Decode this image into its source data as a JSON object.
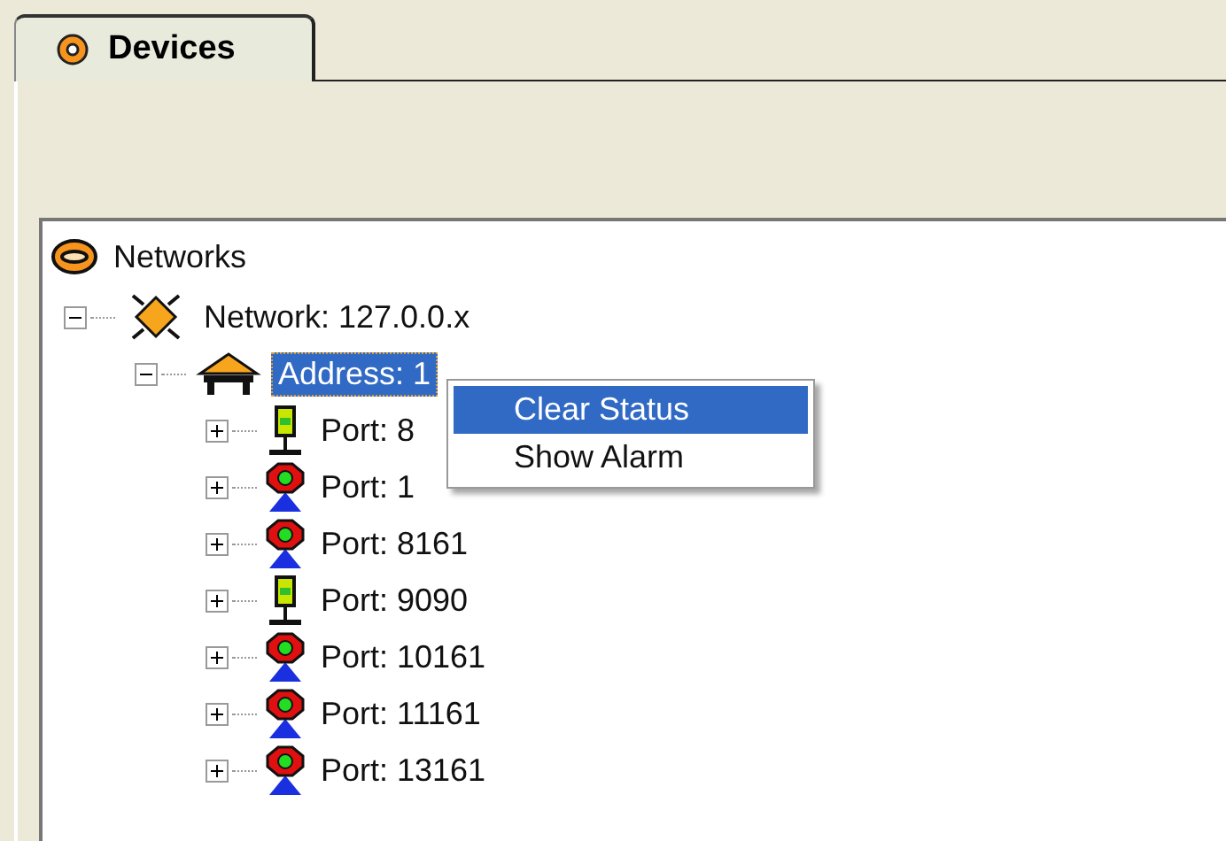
{
  "tabs": [
    {
      "label": "Devices",
      "selected": true
    }
  ],
  "tree": [
    {
      "label": "Networks",
      "kind": "networks",
      "selected": false,
      "children": [
        {
          "label": "Network: 127.0.0.x",
          "kind": "network",
          "expanded": true,
          "selected": false,
          "children": [
            {
              "label": "Address: 1",
              "kind": "address",
              "expanded": true,
              "selected": true,
              "children": [
                {
                  "label": "Port: 8",
                  "kind": "lamp",
                  "expanded": false,
                  "selected": false
                },
                {
                  "label": "Port: 1",
                  "kind": "beacon",
                  "expanded": false,
                  "selected": false
                },
                {
                  "label": "Port: 8161",
                  "kind": "beacon",
                  "expanded": false,
                  "selected": false
                },
                {
                  "label": "Port: 9090",
                  "kind": "lamp",
                  "expanded": false,
                  "selected": false
                },
                {
                  "label": "Port: 10161",
                  "kind": "beacon",
                  "expanded": false,
                  "selected": false
                },
                {
                  "label": "Port: 11161",
                  "kind": "beacon",
                  "expanded": false,
                  "selected": false
                },
                {
                  "label": "Port: 13161",
                  "kind": "beacon",
                  "expanded": false,
                  "selected": false
                }
              ]
            }
          ]
        }
      ]
    }
  ],
  "context_menu": [
    {
      "label": "Clear Status",
      "selected": true
    },
    {
      "label": "Show Alarm",
      "selected": false
    }
  ]
}
